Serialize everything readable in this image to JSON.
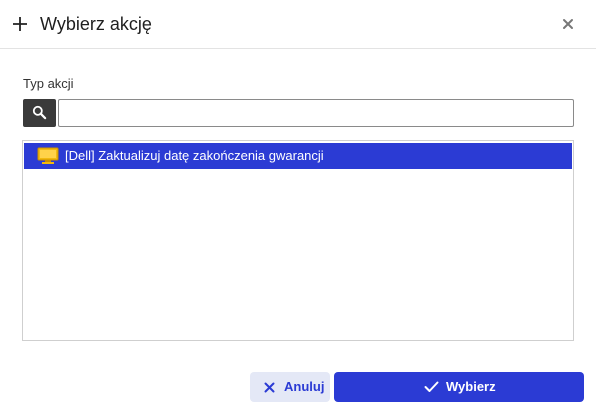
{
  "dialog": {
    "title": "Wybierz akcję",
    "title_icon": "plus-icon",
    "close_icon": "close-icon"
  },
  "form": {
    "field_label": "Typ akcji",
    "search_icon": "search-icon",
    "search_value": "",
    "search_placeholder": ""
  },
  "list": {
    "items": [
      {
        "label": "[Dell] Zaktualizuj datę zakończenia gwarancji",
        "icon": "monitor-icon",
        "selected": true
      }
    ]
  },
  "footer": {
    "cancel_label": "Anuluj",
    "cancel_icon": "x-icon",
    "confirm_label": "Wybierz",
    "confirm_icon": "check-icon"
  },
  "colors": {
    "accent": "#2b3bd4",
    "cancel_bg": "#e4e8f6",
    "search_button_bg": "#3a3a3a",
    "monitor_icon": "#f2b90f"
  }
}
